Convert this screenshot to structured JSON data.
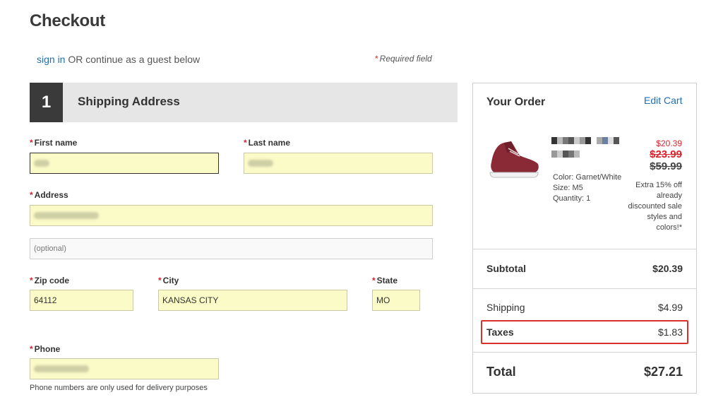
{
  "page_title": "Checkout",
  "signin": {
    "link": "sign in",
    "rest": " OR continue as a guest below",
    "required_note": "Required field",
    "asterisk": "*"
  },
  "shipping": {
    "step": "1",
    "title": "Shipping Address",
    "first_name_label": "First name",
    "last_name_label": "Last name",
    "address_label": "Address",
    "address2_placeholder": "(optional)",
    "zip_label": "Zip code",
    "zip_value": "64112",
    "city_label": "City",
    "city_value": "KANSAS CITY",
    "state_label": "State",
    "state_value": "MO",
    "phone_label": "Phone",
    "phone_note": "Phone numbers are only used for delivery purposes"
  },
  "order": {
    "title": "Your Order",
    "edit_cart": "Edit Cart",
    "product": {
      "image_icon": "shoe-image",
      "color": "Color:  Garnet/White",
      "size": "Size:  M5",
      "quantity": "Quantity: 1",
      "price_sale": "$20.39",
      "price_was": "$23.99",
      "price_orig": "$59.99",
      "promo": "Extra 15% off already discounted sale styles and colors!*"
    },
    "subtotal_label": "Subtotal",
    "subtotal_value": "$20.39",
    "shipping_label": "Shipping",
    "shipping_value": "$4.99",
    "taxes_label": "Taxes",
    "taxes_value": "$1.83",
    "total_label": "Total",
    "total_value": "$27.21"
  },
  "colors": {
    "accent_link": "#1f6fb2",
    "required_red": "#d9232d",
    "field_yellow": "#fbfbc8",
    "highlight_box": "#d9322c"
  }
}
